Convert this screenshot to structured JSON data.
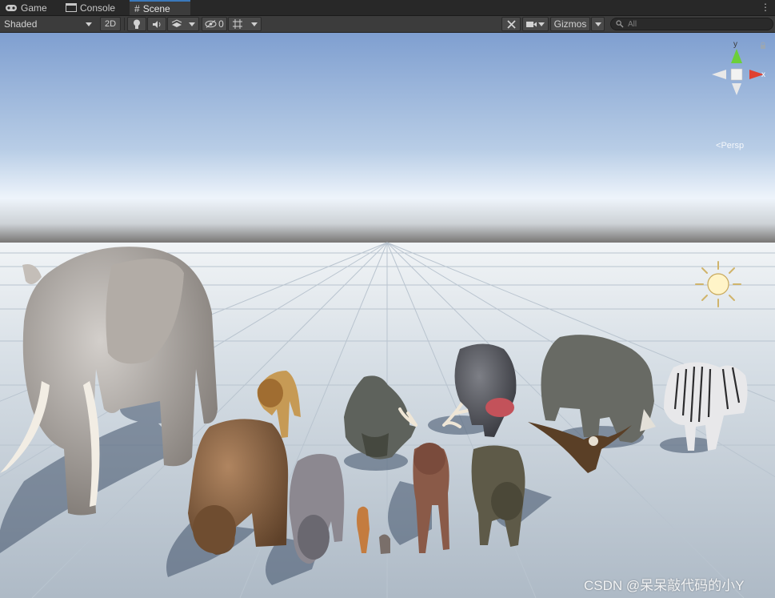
{
  "tabs": [
    {
      "label": "Game",
      "icon": "gamepad-icon"
    },
    {
      "label": "Console",
      "icon": "console-icon"
    },
    {
      "label": "Scene",
      "icon": "scene-grid-icon",
      "active": true
    }
  ],
  "toolbar": {
    "shading_mode": "Shaded",
    "toggle_2d": "2D",
    "hidden_count": "0",
    "gizmos_label": "Gizmos",
    "search_placeholder": "All"
  },
  "gizmo": {
    "axis_y": "y",
    "axis_x": "x",
    "projection": "Persp"
  },
  "scene_objects": [
    "elephant",
    "lion",
    "bear",
    "boar",
    "crocodile",
    "meerkat",
    "rabbit",
    "deer",
    "hippo",
    "wolf",
    "rhino",
    "eagle",
    "zebra",
    "directional-light"
  ],
  "watermark": "CSDN @呆呆敲代码的小Y",
  "colors": {
    "accent": "#3a79bb",
    "sky_top": "#7f9fd0",
    "ground": "#c9d3dc",
    "axis_x": "#e04030",
    "axis_y": "#6ccf3a"
  }
}
